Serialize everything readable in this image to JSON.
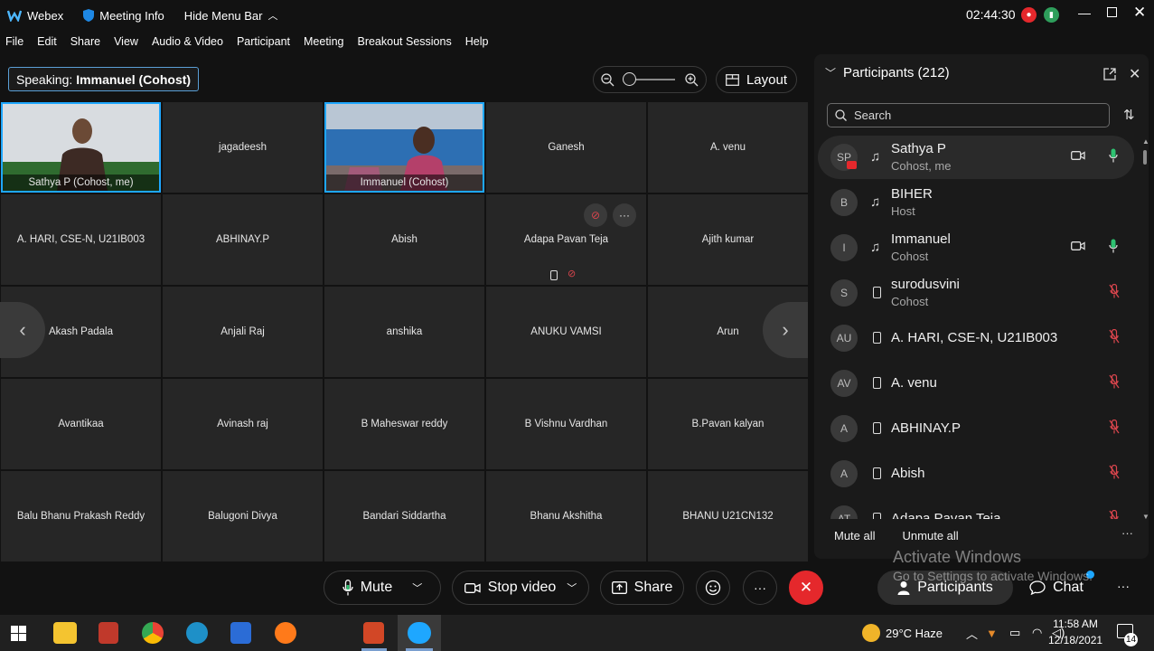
{
  "titlebar": {
    "app_name": "Webex",
    "meeting_info": "Meeting Info",
    "hide_menu_bar": "Hide Menu Bar",
    "timer": "02:44:30"
  },
  "menu": [
    "File",
    "Edit",
    "Share",
    "View",
    "Audio & Video",
    "Participant",
    "Meeting",
    "Breakout Sessions",
    "Help"
  ],
  "speaking": {
    "label": "Speaking:",
    "name": "Immanuel (Cohost)"
  },
  "layout_label": "Layout",
  "tiles": [
    "Sathya P  (Cohost, me)",
    "jagadeesh",
    "Immanuel  (Cohost)",
    "Ganesh",
    "A. venu",
    "A. HARI, CSE-N, U21IB003",
    "ABHINAY.P",
    "Abish",
    "Adapa Pavan Teja",
    "Ajith kumar",
    "Akash Padala",
    "Anjali Raj",
    "anshika",
    "ANUKU VAMSI",
    "Arun",
    "Avantikaa",
    "Avinash raj",
    "B Maheswar reddy",
    "B Vishnu Vardhan",
    "B.Pavan kalyan",
    "Balu Bhanu Prakash Reddy",
    "Balugoni Divya",
    "Bandari Siddartha",
    "Bhanu Akshitha",
    "BHANU U21CN132"
  ],
  "panel": {
    "title": "Participants (212)",
    "search_placeholder": "Search",
    "participants": [
      {
        "initials": "SP",
        "name": "Sathya P",
        "role": "Cohost, me"
      },
      {
        "initials": "B",
        "name": "BIHER",
        "role": "Host"
      },
      {
        "initials": "I",
        "name": "Immanuel",
        "role": "Cohost"
      },
      {
        "initials": "S",
        "name": "surodusvini",
        "role": "Cohost"
      },
      {
        "initials": "AU",
        "name": "A. HARI, CSE-N, U21IB003",
        "role": ""
      },
      {
        "initials": "AV",
        "name": "A. venu",
        "role": ""
      },
      {
        "initials": "A",
        "name": "ABHINAY.P",
        "role": ""
      },
      {
        "initials": "A",
        "name": "Abish",
        "role": ""
      },
      {
        "initials": "AT",
        "name": "Adapa Pavan Teja",
        "role": ""
      }
    ],
    "mute_all": "Mute all",
    "unmute_all": "Unmute all"
  },
  "controls": {
    "mute": "Mute",
    "stop_video": "Stop video",
    "share": "Share",
    "participants": "Participants",
    "chat": "Chat"
  },
  "watermark": {
    "title": "Activate Windows",
    "subtitle": "Go to Settings to activate Windows."
  },
  "taskbar": {
    "weather": "29°C  Haze",
    "time": "11:58 AM",
    "date": "12/18/2021",
    "notifications": "14"
  },
  "colors": {
    "accent": "#1ea7ff",
    "leave": "#e5282c",
    "mic_green": "#2ec271",
    "muted_red": "#d9454d"
  }
}
